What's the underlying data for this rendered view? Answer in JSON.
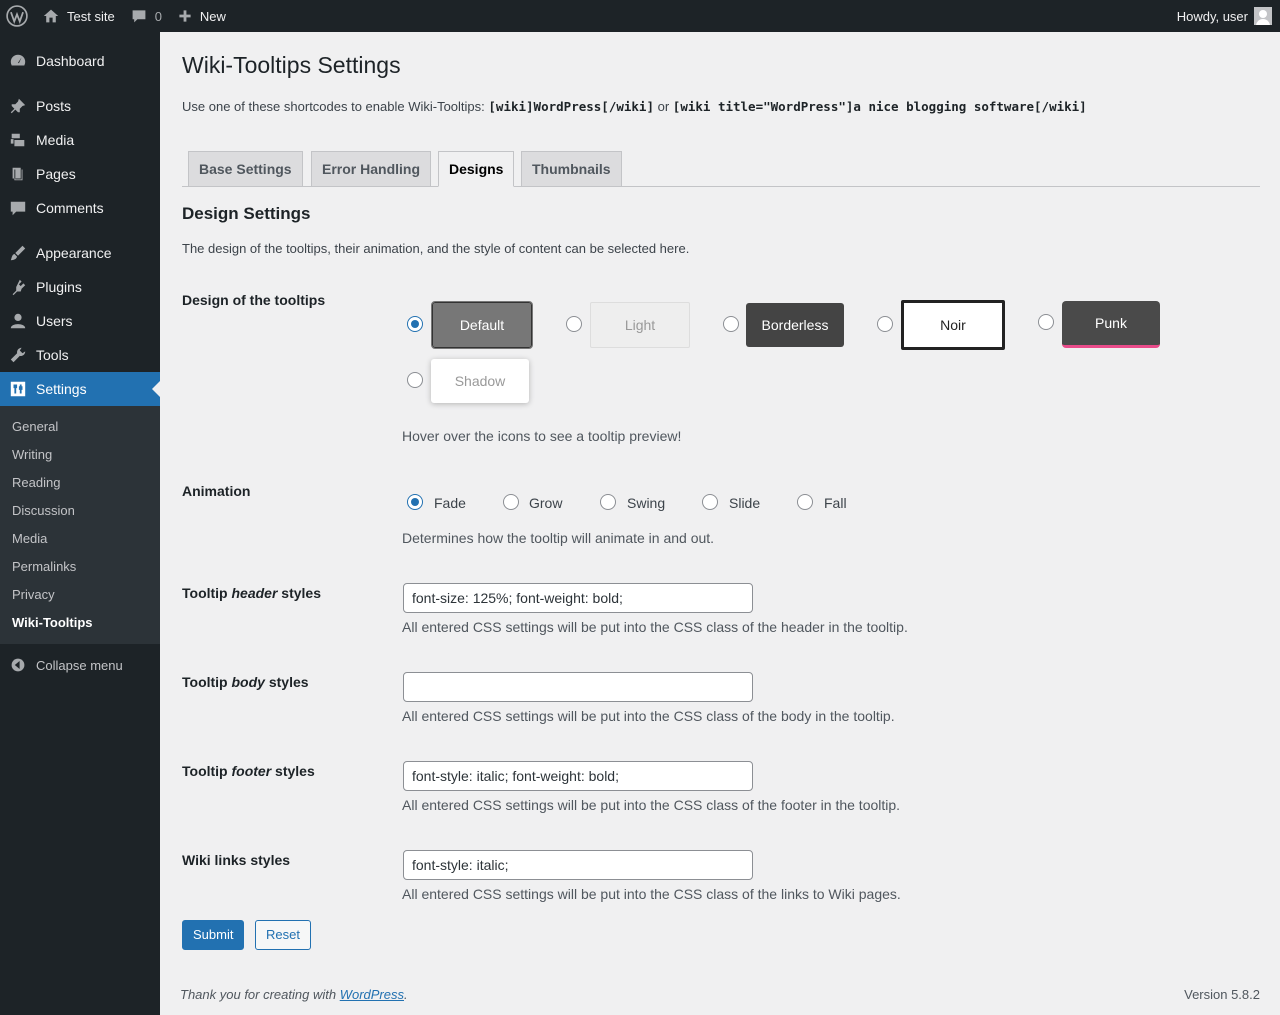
{
  "adminbar": {
    "site_name": "Test site",
    "comments_count": "0",
    "new_label": "New",
    "howdy": "Howdy, user"
  },
  "sidebar": {
    "items": [
      {
        "label": "Dashboard",
        "icon": "dashboard-icon"
      },
      {
        "label": "Posts",
        "icon": "pushpin-icon"
      },
      {
        "label": "Media",
        "icon": "media-icon"
      },
      {
        "label": "Pages",
        "icon": "pages-icon"
      },
      {
        "label": "Comments",
        "icon": "comment-icon"
      },
      {
        "label": "Appearance",
        "icon": "paintbrush-icon"
      },
      {
        "label": "Plugins",
        "icon": "plugin-icon"
      },
      {
        "label": "Users",
        "icon": "users-icon"
      },
      {
        "label": "Tools",
        "icon": "wrench-icon"
      },
      {
        "label": "Settings",
        "icon": "settings-icon"
      }
    ],
    "submenu": [
      "General",
      "Writing",
      "Reading",
      "Discussion",
      "Media",
      "Permalinks",
      "Privacy",
      "Wiki-Tooltips"
    ],
    "collapse_label": "Collapse menu"
  },
  "page": {
    "title": "Wiki-Tooltips Settings",
    "intro_prefix": "Use one of these shortcodes to enable Wiki-Tooltips:",
    "code1": "[wiki]WordPress[/wiki]",
    "intro_or": "or",
    "code2": "[wiki title=\"WordPress\"]a nice blogging software[/wiki]",
    "tabs": [
      "Base Settings",
      "Error Handling",
      "Designs",
      "Thumbnails"
    ],
    "active_tab": "Designs",
    "section_title": "Design Settings",
    "section_desc": "The design of the tooltips, their animation, and the style of content can be selected here."
  },
  "designs": {
    "label": "Design of the tooltips",
    "options": [
      "Default",
      "Light",
      "Borderless",
      "Noir",
      "Punk",
      "Shadow"
    ],
    "selected": "Default",
    "help": "Hover over the icons to see a tooltip preview!"
  },
  "animation": {
    "label": "Animation",
    "options": [
      "Fade",
      "Grow",
      "Swing",
      "Slide",
      "Fall"
    ],
    "selected": "Fade",
    "help": "Determines how the tooltip will animate in and out."
  },
  "header_styles": {
    "label_pre": "Tooltip ",
    "label_em": "header",
    "label_post": " styles",
    "value": "font-size: 125%; font-weight: bold;",
    "help": "All entered CSS settings will be put into the CSS class of the header in the tooltip."
  },
  "body_styles": {
    "label_pre": "Tooltip ",
    "label_em": "body",
    "label_post": " styles",
    "value": "",
    "help": "All entered CSS settings will be put into the CSS class of the body in the tooltip."
  },
  "footer_styles": {
    "label_pre": "Tooltip ",
    "label_em": "footer",
    "label_post": " styles",
    "value": "font-style: italic; font-weight: bold;",
    "help": "All entered CSS settings will be put into the CSS class of the footer in the tooltip."
  },
  "links_styles": {
    "label": "Wiki links styles",
    "value": "font-style: italic;",
    "help": "All entered CSS settings will be put into the CSS class of the links to Wiki pages."
  },
  "buttons": {
    "submit": "Submit",
    "reset": "Reset"
  },
  "footer": {
    "thanks_pre": "Thank you for creating with ",
    "thanks_link": "WordPress",
    "thanks_post": ".",
    "version": "Version 5.8.2"
  },
  "colors": {
    "accent": "#2271b1",
    "sidebar": "#1d2327",
    "punk_accent": "#e94b8a"
  }
}
